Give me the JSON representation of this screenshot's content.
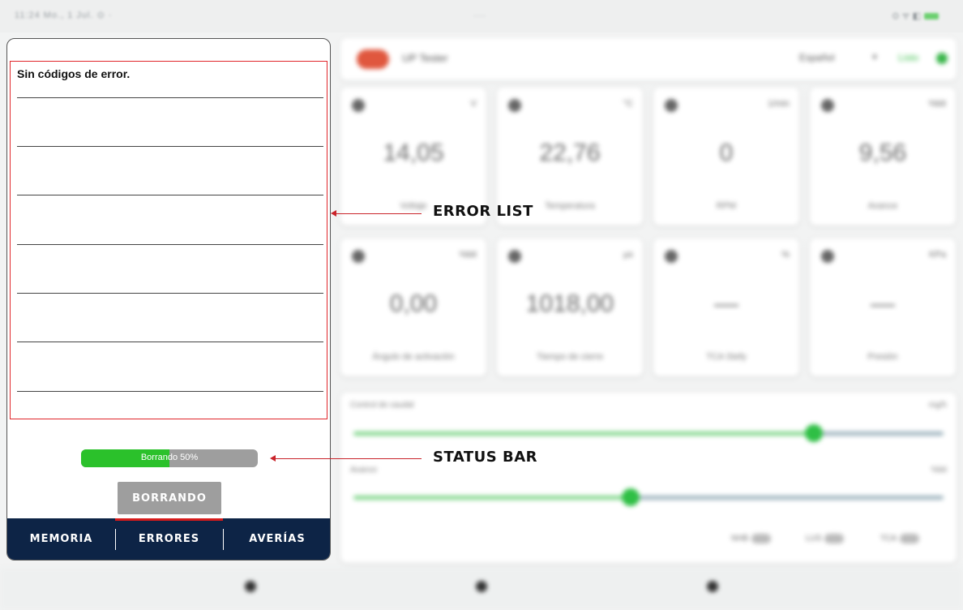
{
  "statusbar": {
    "time": "11:24 Mo., 1 Jul. ⊙ ·",
    "center": "·····",
    "right": "⊙ ᯤ ◧"
  },
  "app": {
    "title": "UP Tester",
    "language": "Español",
    "connection": "Listo",
    "logo_color": "#e0573e"
  },
  "cards": [
    {
      "icon": "battery-icon",
      "unit": "V",
      "value": "14,05",
      "label": "Voltaje"
    },
    {
      "icon": "thermometer-icon",
      "unit": "°C",
      "value": "22,76",
      "label": "Temperatura"
    },
    {
      "icon": "engine-icon",
      "unit": "1/min",
      "value": "0",
      "label": "RPM"
    },
    {
      "icon": "advance-icon",
      "unit": "%bit",
      "value": "9,56",
      "label": "Avance"
    },
    {
      "icon": "angle-icon",
      "unit": "%bit",
      "value": "0,00",
      "label": "Ángulo de activación"
    },
    {
      "icon": "clock-icon",
      "unit": "µs",
      "value": "1018,00",
      "label": "Tiempo de cierre"
    },
    {
      "icon": "tca-icon",
      "unit": "%",
      "value": "—",
      "label": "TCA Stefy"
    },
    {
      "icon": "pressure-icon",
      "unit": "KPa",
      "value": "—",
      "label": "Presión"
    }
  ],
  "controls": {
    "flow_label": "Control de caudal",
    "flow_unit": "mg/h",
    "flow_level": 0.78,
    "second_label": "Avance",
    "second_unit": "%bit",
    "second_level": 0.47,
    "toggles": [
      "NHB",
      "LUS",
      "TCA"
    ]
  },
  "dialog": {
    "error_title": "Sin códigos de error.",
    "progress_text": "Borrando 50%",
    "progress_fraction": 0.5,
    "erase_button": "BORRANDO",
    "tabs": [
      "MEMORIA",
      "ERRORES",
      "AVERÍAS"
    ],
    "active_tab": 1
  },
  "annotations": {
    "error_list": "ERROR LIST",
    "status_bar": "STATUS BAR"
  },
  "colors": {
    "accent_green": "#2bc12b",
    "tab_bar": "#0d2446",
    "tab_underline": "#d61b1b",
    "annotation": "#c9232a"
  }
}
